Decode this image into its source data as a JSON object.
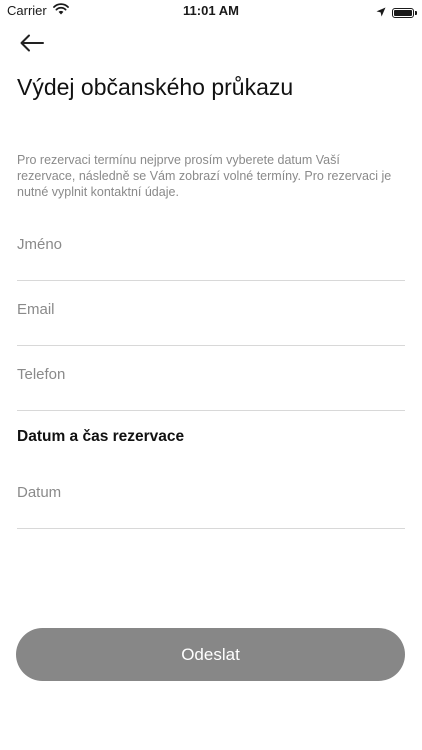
{
  "status_bar": {
    "carrier": "Carrier",
    "time": "11:01 AM"
  },
  "header": {
    "back_icon": "arrow-left-icon",
    "title": "Výdej občanského průkazu"
  },
  "intro_text": "Pro rezervaci termínu nejprve prosím vyberete datum Vaší rezervace, následně se Vám zobrazí volné termíny. Pro rezervaci je nutné vyplnit kontaktní údaje.",
  "form": {
    "name_placeholder": "Jméno",
    "email_placeholder": "Email",
    "phone_placeholder": "Telefon",
    "section_heading": "Datum a čas rezervace",
    "date_placeholder": "Datum",
    "submit_label": "Odeslat"
  },
  "colors": {
    "button_background": "#878787",
    "placeholder": "#8a8a8a",
    "divider": "#d8d8d8"
  }
}
